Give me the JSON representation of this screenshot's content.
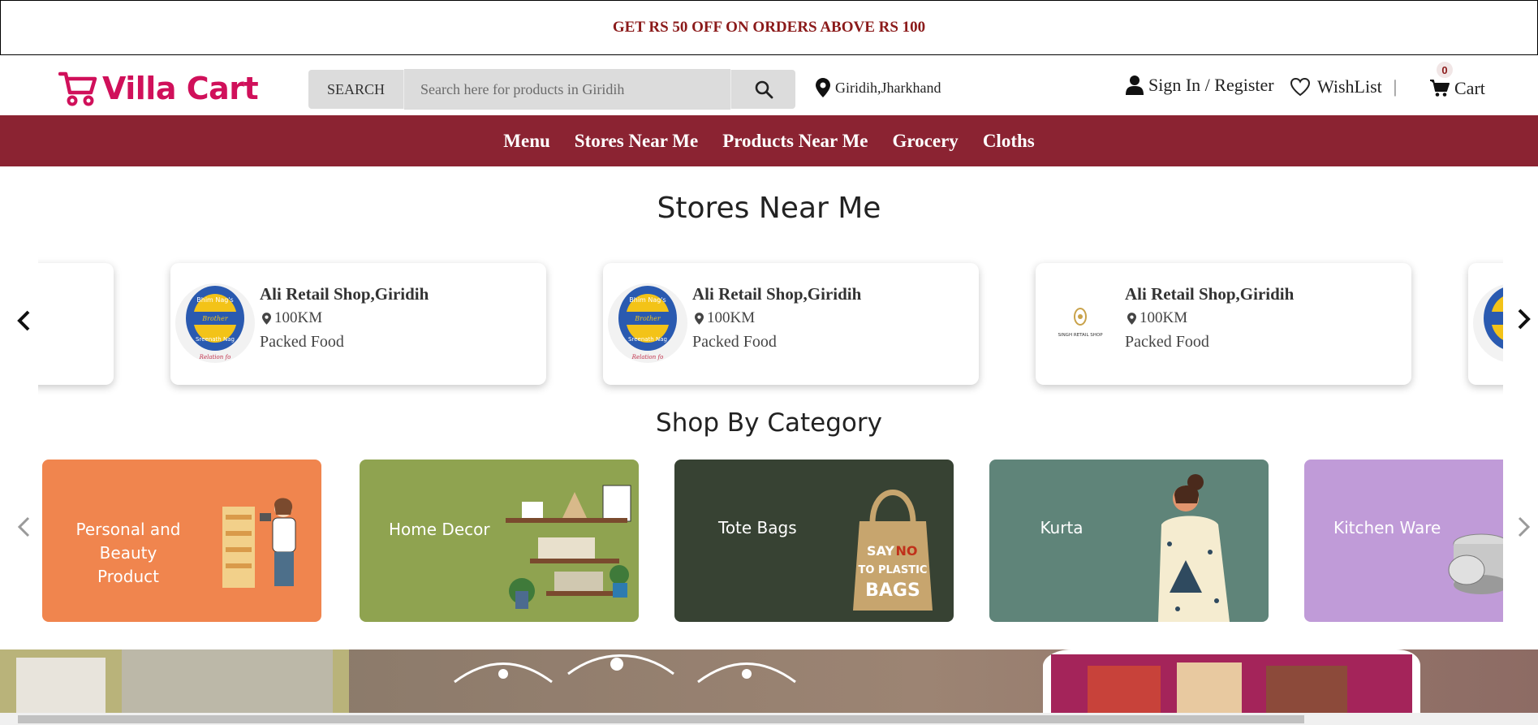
{
  "promo": {
    "text": "GET RS 50 OFF ON ORDERS ABOVE RS 100"
  },
  "brand": {
    "name": "Villa Cart",
    "color": "#d0105a"
  },
  "search": {
    "label": "SEARCH",
    "placeholder": "Search here for products in Giridih"
  },
  "location": {
    "text": "Giridih,Jharkhand"
  },
  "account": {
    "sign_in": "Sign In / Register",
    "wishlist": "WishList",
    "separator": "|",
    "cart": "Cart",
    "cart_count": "0"
  },
  "nav": {
    "items": [
      "Menu",
      "Stores Near Me",
      "Products Near Me",
      "Grocery",
      "Cloths"
    ],
    "color": "#8b2332"
  },
  "stores_section": {
    "title": "Stores Near Me",
    "stores": [
      {
        "name": "Ali Retail Shop,Giridih",
        "distance": "100KM",
        "category": "Packed Food",
        "logo": "bhim-nags-logo"
      },
      {
        "name": "Ali Retail Shop,Giridih",
        "distance": "100KM",
        "category": "Packed Food",
        "logo": "bhim-nags-logo"
      },
      {
        "name": "Ali Retail Shop,Giridih",
        "distance": "100KM",
        "category": "Packed Food",
        "logo": "singh-retail-shop-logo"
      }
    ],
    "logo_text": {
      "bhim_top": "Bhim Nag's",
      "bhim_mid": "Brother",
      "bhim_bottom": "Sreenath Nag",
      "bhim_tag": "Relation fo",
      "singh": "SINGH RETAIL SHOP"
    }
  },
  "category_section": {
    "title": "Shop By Category",
    "categories": [
      {
        "name": "Personal and Beauty Product",
        "line1": "Personal and Beauty",
        "line2": "Product",
        "color": "#f0854e"
      },
      {
        "name": "Home Decor",
        "color": "#8fa350"
      },
      {
        "name": "Tote Bags",
        "color": "#374233",
        "bag_text1": "SAY",
        "bag_text2": "NO",
        "bag_text3": "TO PLASTIC",
        "bag_text4": "BAGS"
      },
      {
        "name": "Kurta",
        "color": "#5f8479"
      },
      {
        "name": "Kitchen Ware",
        "color": "#c09bd8"
      }
    ]
  }
}
